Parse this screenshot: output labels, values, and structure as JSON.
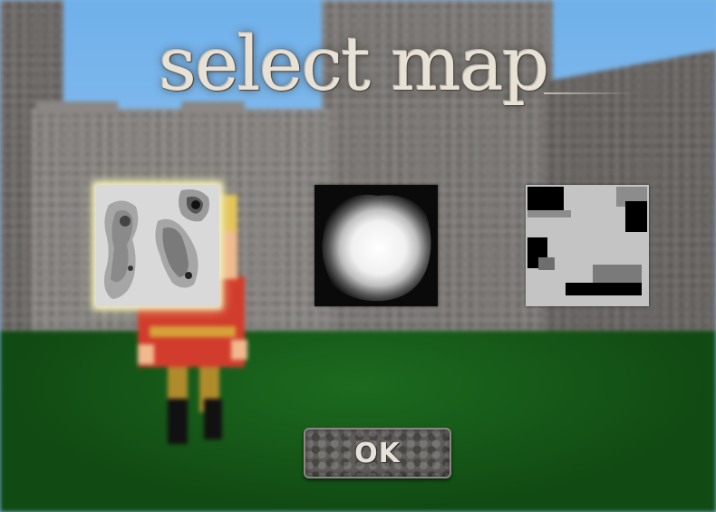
{
  "screen": {
    "title": "select map"
  },
  "maps": [
    {
      "selected": true,
      "style": "contour-islands"
    },
    {
      "selected": false,
      "style": "radial-blob"
    },
    {
      "selected": false,
      "style": "block-rooms"
    }
  ],
  "ok_button": {
    "label": "OK"
  },
  "colors": {
    "selection_glow": "#f2efc0",
    "ground": "#1c6a1f",
    "sky": "#6fb0ea",
    "stone": "#7d7a77"
  }
}
